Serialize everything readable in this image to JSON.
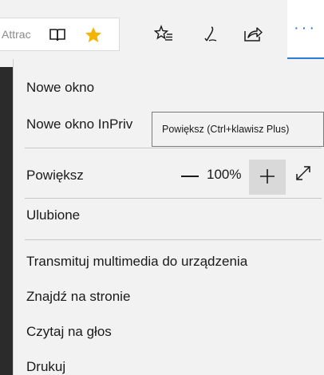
{
  "toolbar": {
    "address_text": "Attrac",
    "icons": [
      "reading-view-icon",
      "favorite-star-icon",
      "favorites-hub-icon",
      "pen-notes-icon",
      "share-icon",
      "more-icon"
    ],
    "star_color": "#f5b400",
    "accent_color": "#2b7cd3"
  },
  "menu": {
    "new_window": "Nowe okno",
    "new_inprivate": "Nowe okno InPriv",
    "zoom_label": "Powiększ",
    "zoom_value": "100%",
    "favorites": "Ulubione",
    "cast": "Transmituj multimedia do urządzenia",
    "find": "Znajdź na stronie",
    "read_aloud": "Czytaj na głos",
    "print": "Drukuj"
  },
  "tooltip": {
    "text": "Powiększ (Ctrl+klawisz Plus)"
  }
}
